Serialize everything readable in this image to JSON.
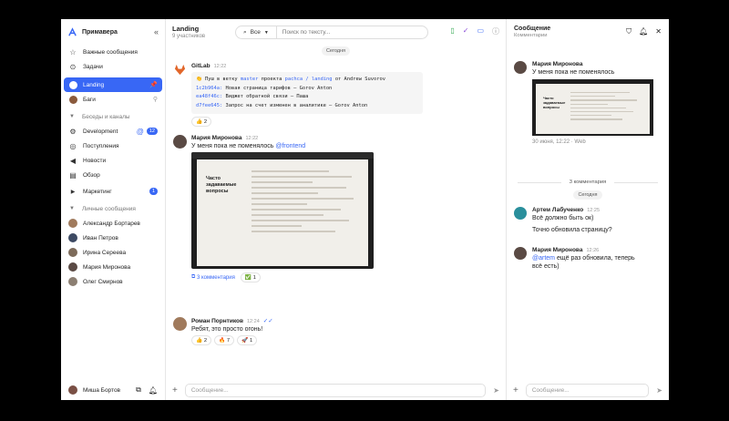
{
  "workspace": {
    "name": "Примавера"
  },
  "sidebar": {
    "important": "Важные сообщения",
    "tasks": "Задачи",
    "channels": [
      {
        "label": "Landing"
      },
      {
        "label": "Баги"
      }
    ],
    "section_chats": "Беседы и каналы",
    "development": {
      "label": "Development",
      "badge": "12"
    },
    "incoming": "Поступления",
    "news": "Новости",
    "overview": "Обзор",
    "marketing": {
      "label": "Маркетинг",
      "badge": "1"
    },
    "section_personal": "Личные сообщения",
    "people": [
      "Александр Бортарев",
      "Иван Петров",
      "Ирина Сереева",
      "Мария Миронова",
      "Олег Смирнов"
    ],
    "me": "Миша Бортов"
  },
  "main": {
    "title": "Landing",
    "subtitle": "9 участников",
    "search_scope": "Все",
    "search_placeholder": "Поиск по тексту...",
    "date_label": "Сегодня",
    "composer_placeholder": "Сообщение...",
    "messages": {
      "gitlab": {
        "author": "GitLab",
        "time": "12:22",
        "push_prefix": "👏 Пуш в ветку",
        "branch": "master",
        "push_mid": "проекта",
        "project": "pachca / landing",
        "push_suffix": "от Andrew Suvorov",
        "commits": [
          {
            "hash": "1c2b964a:",
            "text": "Новая страница тарифов — Gorov Anton"
          },
          {
            "hash": "ea48f46c:",
            "text": "Виджет обратной связи — Паша"
          },
          {
            "hash": "d7fee645:",
            "text": "Запрос на счет изменен в аналитике — Gorov Anton"
          }
        ],
        "reaction": {
          "emoji": "👍",
          "count": "2"
        }
      },
      "maria": {
        "author": "Мария Миронова",
        "time": "12:22",
        "text": "У меня пока не поменялось",
        "mention": "@frontend",
        "shot_title_1": "Часто",
        "shot_title_2": "задаваемые",
        "shot_title_3": "вопросы",
        "thread_label": "3 комментария",
        "reaction": {
          "emoji": "✅",
          "count": "1"
        }
      },
      "roman": {
        "author": "Роман Порнтиков",
        "time": "12:24",
        "text": "Ребят, это просто огонь!",
        "reactions": [
          {
            "emoji": "👍",
            "count": "2"
          },
          {
            "emoji": "🔥",
            "count": "7"
          },
          {
            "emoji": "🚀",
            "count": "1"
          }
        ]
      }
    }
  },
  "thread": {
    "title": "Сообщение",
    "subtitle": "Комментарии",
    "root": {
      "author": "Мария Миронова",
      "text": "У меня пока не поменялось",
      "shot_title_1": "Часто",
      "shot_title_2": "задаваемые",
      "shot_title_3": "вопросы",
      "meta": "30 июня, 12:22 · Web"
    },
    "count_label": "3 комментария",
    "date_label": "Сегодня",
    "comments": [
      {
        "author": "Артем Лабученко",
        "time": "12:25",
        "line1": "Всё должно быть ок)",
        "line2": "Точно обновила страницу?"
      },
      {
        "author": "Мария Миронова",
        "time": "12:26",
        "mention": "@artem",
        "line1": "ещё раз обновила, теперь",
        "line2": "всё есть)"
      }
    ],
    "composer_placeholder": "Сообщение..."
  }
}
